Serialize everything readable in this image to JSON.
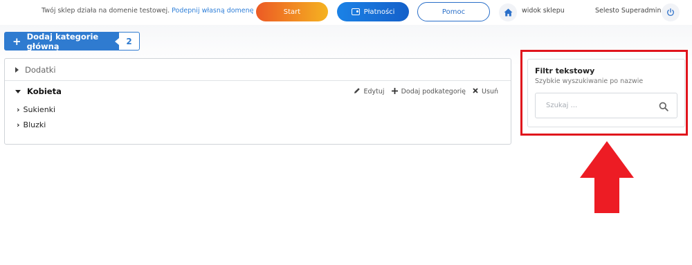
{
  "topbar": {
    "domain_text": "Twój sklep działa na domenie testowej.",
    "domain_link": "Podepnij własną domenę",
    "start_label": "Start",
    "payments_label": "Płatności",
    "help_label": "Pomoc",
    "shop_view_label": "widok sklepu",
    "user_label": "Selesto Superadmin"
  },
  "toolbar": {
    "add_category_label": "Dodaj kategorie główną",
    "category_count": "2"
  },
  "tree": {
    "categories": [
      {
        "label": "Dodatki",
        "expanded": false
      },
      {
        "label": "Kobieta",
        "expanded": true,
        "children": [
          "Sukienki",
          "Bluzki"
        ]
      }
    ],
    "actions": {
      "edit": "Edytuj",
      "add_sub": "Dodaj podkategorię",
      "delete": "Usuń"
    }
  },
  "filter": {
    "title": "Filtr tekstowy",
    "subtitle": "Szybkie wyszukiwanie po nazwie",
    "placeholder": "Szukaj ..."
  },
  "colors": {
    "accent": "#2f7bd0",
    "highlight": "#e0141c",
    "start_gradient": [
      "#ec5a24",
      "#f5b321"
    ]
  }
}
